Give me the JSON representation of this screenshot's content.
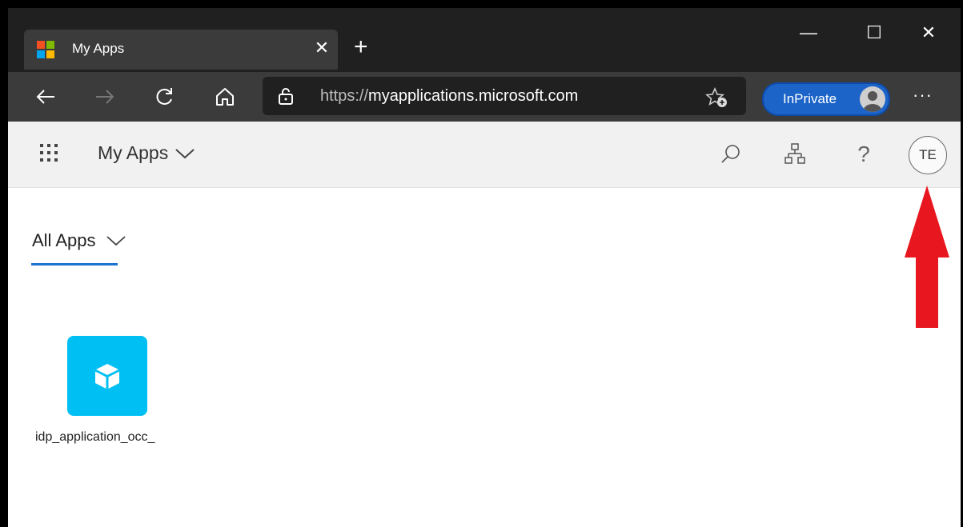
{
  "browser": {
    "tab": {
      "title": "My Apps",
      "close_glyph": "✕"
    },
    "new_tab_glyph": "+",
    "window_controls": {
      "minimize": "—",
      "maximize": "☐",
      "close": "✕"
    },
    "address": {
      "protocol": "https://",
      "host": "myapplications.microsoft.com"
    },
    "inprivate_label": "InPrivate",
    "more_glyph": "···"
  },
  "app_header": {
    "title": "My Apps",
    "user_initials": "TE",
    "help_glyph": "?"
  },
  "content": {
    "filter_label": "All Apps",
    "apps": [
      {
        "name": "idp_application_occ_",
        "tile_color": "#00bff3",
        "icon": "cube-icon"
      }
    ]
  },
  "colors": {
    "accent": "#1b74d1",
    "inprivate": "#1c64c8",
    "annotation_arrow": "#e8161e"
  }
}
